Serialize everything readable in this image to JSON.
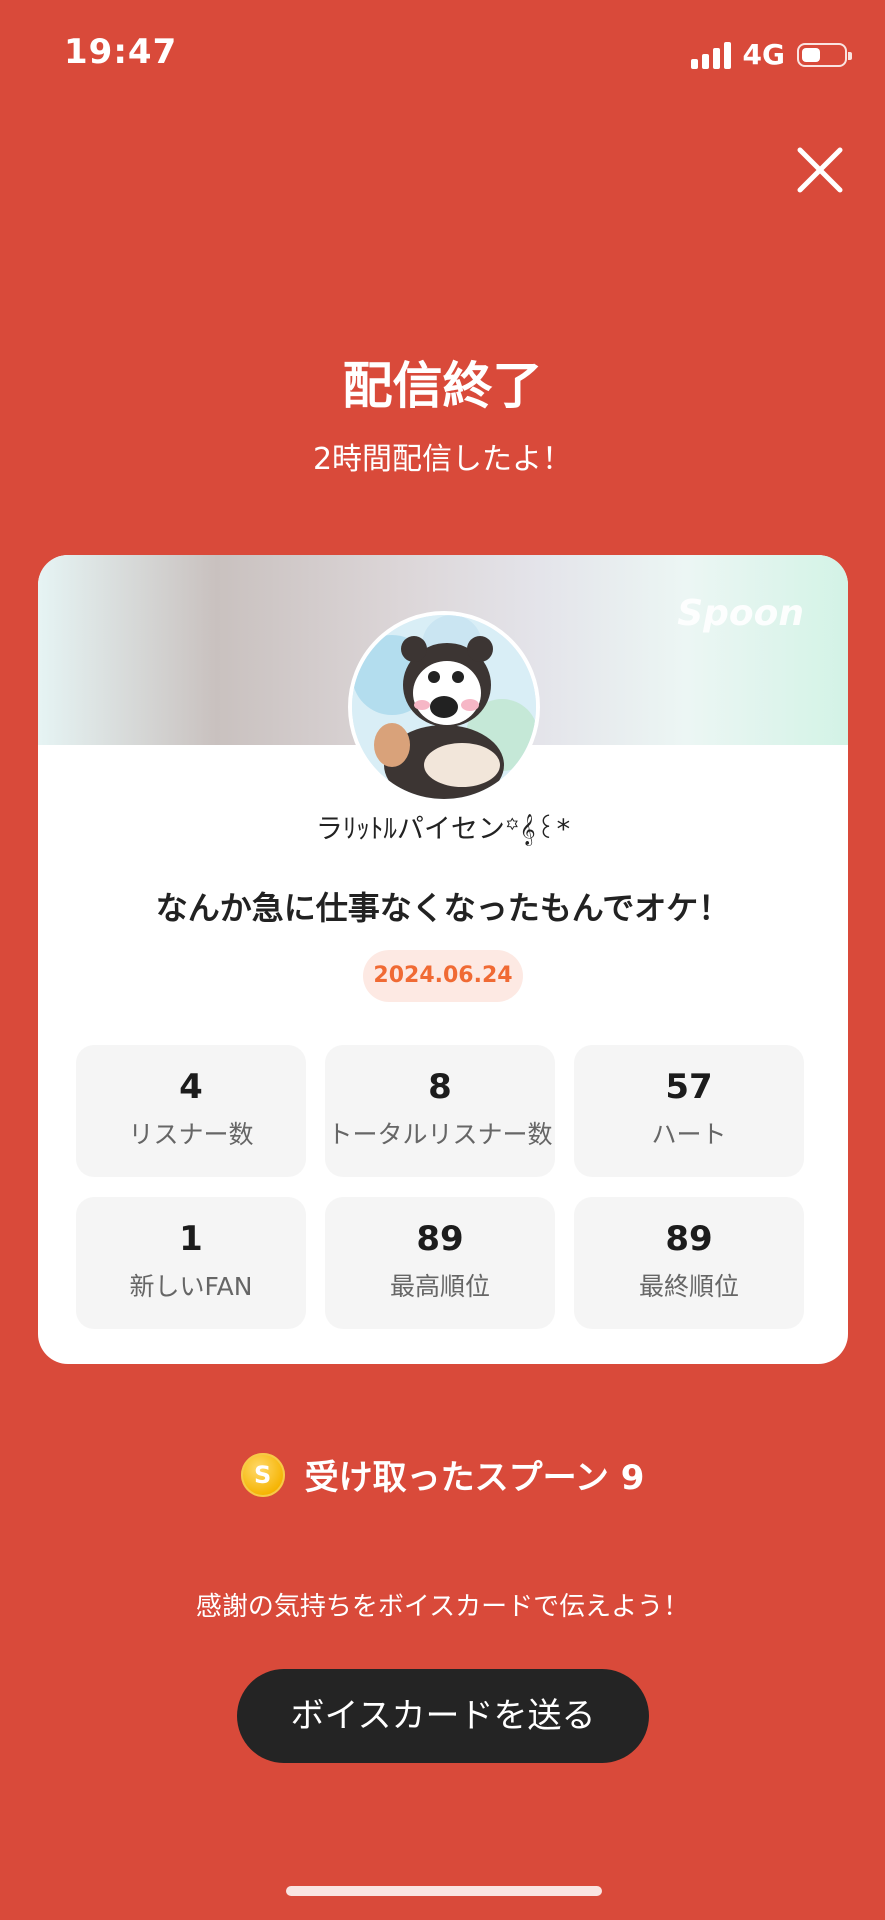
{
  "status": {
    "time": "19:47",
    "network": "4G",
    "battery_level": 0.45
  },
  "header": {
    "title": "配信終了",
    "subtitle": "2時間配信したよ！"
  },
  "card": {
    "brand": "Spoon",
    "dj_name": "ラﾘｯﾄﾙパイセン꙳𝄞꒰*",
    "title": "なんか急に仕事なくなったもんでオケ！",
    "date": "2024.06.24",
    "stats": [
      {
        "value": "4",
        "label": "リスナー数"
      },
      {
        "value": "8",
        "label": "トータルリスナー数"
      },
      {
        "value": "57",
        "label": "ハート"
      },
      {
        "value": "1",
        "label": "新しいFAN"
      },
      {
        "value": "89",
        "label": "最高順位"
      },
      {
        "value": "89",
        "label": "最終順位"
      }
    ]
  },
  "spoons": {
    "coin_letter": "S",
    "label": "受け取ったスプーン 9"
  },
  "voice": {
    "prompt": "感謝の気持ちをボイスカードで伝えよう！",
    "button": "ボイスカードを送る"
  },
  "colors": {
    "background": "#d94a3a",
    "accent": "#f06a34",
    "button": "#242424"
  }
}
